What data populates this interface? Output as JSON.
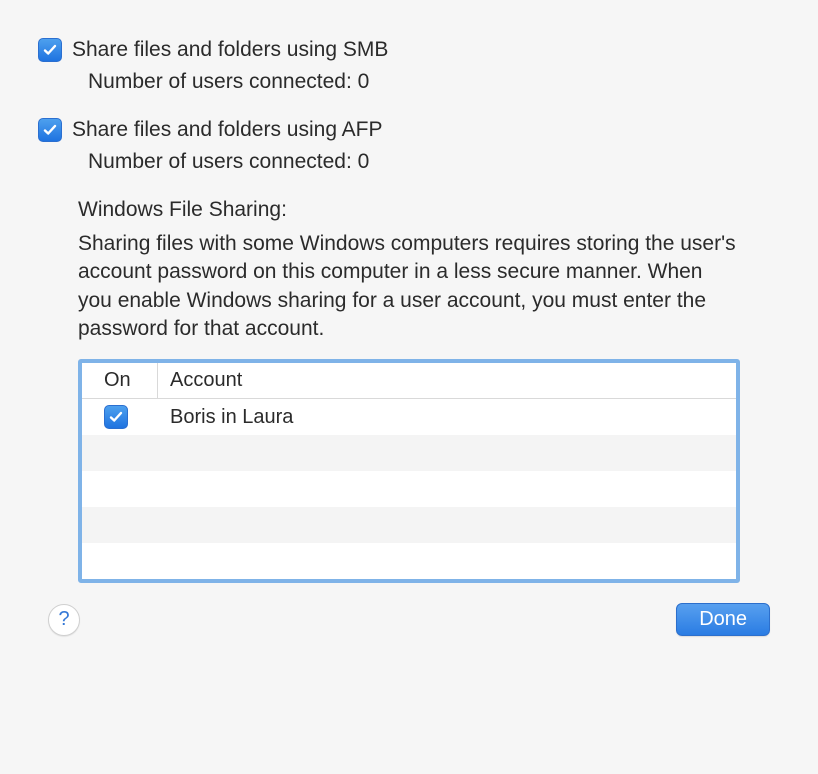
{
  "smb": {
    "label": "Share files and folders using SMB",
    "checked": true,
    "connected_text": "Number of users connected: 0"
  },
  "afp": {
    "label": "Share files and folders using AFP",
    "checked": true,
    "connected_text": "Number of users connected: 0"
  },
  "windows_sharing": {
    "heading": "Windows File Sharing:",
    "description": "Sharing files with some Windows computers requires storing the user's account password on this computer in a less secure manner.  When you enable Windows sharing for a user account, you must enter the password for that account."
  },
  "table": {
    "columns": {
      "on": "On",
      "account": "Account"
    },
    "rows": [
      {
        "on": true,
        "account": "Boris in Laura"
      }
    ]
  },
  "footer": {
    "help": "?",
    "done": "Done"
  }
}
